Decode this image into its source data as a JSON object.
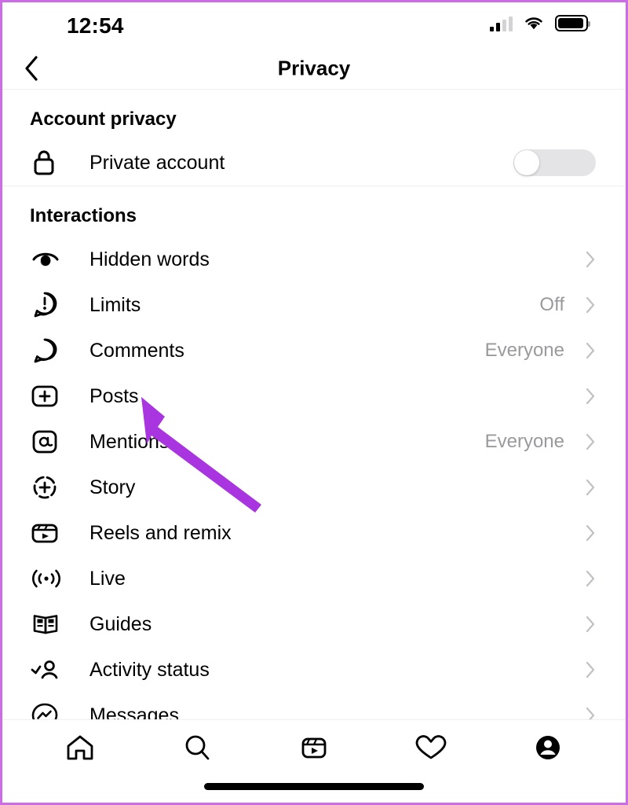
{
  "meta": {
    "accent_purple": "#cc6ce7",
    "arrow_color": "#a935e0",
    "value_gray": "#9a9a9e",
    "chevron_gray": "#c0c0c5"
  },
  "status_bar": {
    "time": "12:54",
    "signal_icon": "cellular-signal-icon",
    "wifi_icon": "wifi-icon",
    "battery_icon": "battery-icon"
  },
  "header": {
    "back_icon": "back-chevron-icon",
    "title": "Privacy"
  },
  "sections": [
    {
      "title": "Account privacy",
      "rows": [
        {
          "icon": "lock-icon",
          "label": "Private account",
          "control": "toggle",
          "value": "",
          "toggle_on": false
        }
      ]
    },
    {
      "title": "Interactions",
      "rows": [
        {
          "icon": "eye-icon",
          "label": "Hidden words",
          "control": "chevron",
          "value": ""
        },
        {
          "icon": "exclamation-bubble-icon",
          "label": "Limits",
          "control": "chevron",
          "value": "Off"
        },
        {
          "icon": "comment-bubble-icon",
          "label": "Comments",
          "control": "chevron",
          "value": "Everyone"
        },
        {
          "icon": "plus-square-icon",
          "label": "Posts",
          "control": "chevron",
          "value": ""
        },
        {
          "icon": "at-sign-icon",
          "label": "Mentions",
          "control": "chevron",
          "value": "Everyone"
        },
        {
          "icon": "story-plus-icon",
          "label": "Story",
          "control": "chevron",
          "value": ""
        },
        {
          "icon": "reels-icon",
          "label": "Reels and remix",
          "control": "chevron",
          "value": ""
        },
        {
          "icon": "live-broadcast-icon",
          "label": "Live",
          "control": "chevron",
          "value": ""
        },
        {
          "icon": "guides-book-icon",
          "label": "Guides",
          "control": "chevron",
          "value": ""
        },
        {
          "icon": "activity-status-icon",
          "label": "Activity status",
          "control": "chevron",
          "value": ""
        },
        {
          "icon": "messenger-icon",
          "label": "Messages",
          "control": "chevron",
          "value": ""
        }
      ]
    }
  ],
  "annotation": {
    "arrow": "purple-arrow-pointing-to-posts",
    "points_to": "Posts"
  },
  "bottom_nav": [
    {
      "icon": "home-icon",
      "label": "Home",
      "active": false
    },
    {
      "icon": "search-icon",
      "label": "Search",
      "active": false
    },
    {
      "icon": "reels-tab-icon",
      "label": "Reels",
      "active": false
    },
    {
      "icon": "heart-icon",
      "label": "Activity",
      "active": false
    },
    {
      "icon": "profile-avatar-icon",
      "label": "Profile",
      "active": true
    }
  ]
}
